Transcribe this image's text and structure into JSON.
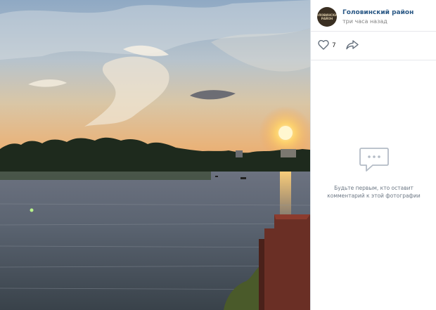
{
  "post": {
    "author_name": "Головинский район",
    "avatar_label": "ГОЛОВИНСКИЙ РАЙОН",
    "time_ago": "три часа назад",
    "likes_count": "7"
  },
  "comments": {
    "empty_line1": "Будьте первым, кто оставит",
    "empty_line2": "комментарий к этой фотографии"
  },
  "icons": {
    "like": "heart-icon",
    "share": "share-arrow-icon",
    "empty_comments": "comment-bubble-icon"
  },
  "colors": {
    "link": "#2a5885",
    "muted": "#828282",
    "icon": "#99a2ad"
  }
}
